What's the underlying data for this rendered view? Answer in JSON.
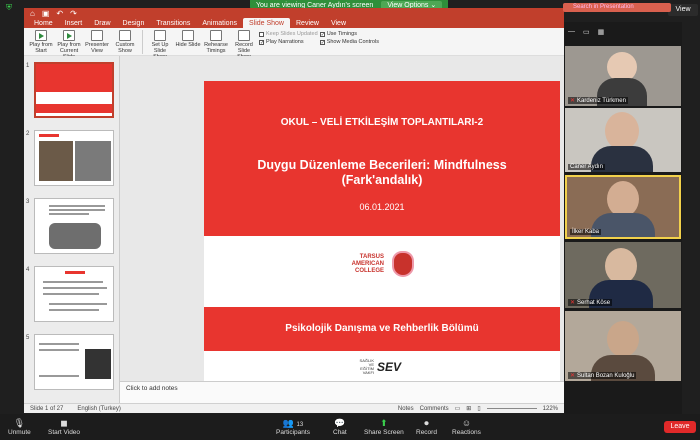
{
  "zoom": {
    "banner_text": "You are viewing Caner Aydın's screen",
    "view_options": "View Options ⌄",
    "view_button": "View",
    "toolbar": [
      {
        "icon": "microphone-muted-icon",
        "label": "Unmute"
      },
      {
        "icon": "video-camera-off-icon",
        "label": "Start Video"
      },
      {
        "icon": "participants-icon",
        "label": "Participants",
        "count": "13"
      },
      {
        "icon": "chat-icon",
        "label": "Chat"
      },
      {
        "icon": "share-screen-icon",
        "label": "Share Screen"
      },
      {
        "icon": "record-icon",
        "label": "Record"
      },
      {
        "icon": "reactions-icon",
        "label": "Reactions"
      }
    ],
    "leave": "Leave",
    "participants": [
      {
        "name": "Kardeniz Türkmen",
        "muted": true
      },
      {
        "name": "Caner Aydın",
        "muted": false
      },
      {
        "name": "İlker Kaba",
        "muted": false,
        "active": true
      },
      {
        "name": "Serhat Köse",
        "muted": true
      },
      {
        "name": "Sultan Bozan Kuloğlu",
        "muted": true
      }
    ]
  },
  "ppt": {
    "search_placeholder": "Search in Presentation",
    "tabs": [
      "Home",
      "Insert",
      "Draw",
      "Design",
      "Transitions",
      "Animations",
      "Slide Show",
      "Review",
      "View"
    ],
    "active_tab": "Slide Show",
    "ribbon_buttons": [
      "Play from Start",
      "Play from Current Slide",
      "Presenter View",
      "Custom Show",
      "Set Up Slide Show",
      "Hide Slide",
      "Rehearse Timings",
      "Record Slide Show"
    ],
    "checkboxes": [
      {
        "label": "Keep Slides Updated",
        "checked": false,
        "disabled": true
      },
      {
        "label": "Use Timings",
        "checked": true
      },
      {
        "label": "Play Narrations",
        "checked": true
      },
      {
        "label": "Show Media Controls",
        "checked": true
      }
    ],
    "thumbnail_numbers": [
      "1",
      "2",
      "3",
      "4",
      "5"
    ],
    "slide": {
      "header": "OKUL – VELİ ETKİLEŞİM TOPLANTILARI-2",
      "title": "Duygu Düzenleme Becerileri: Mindfulness (Fark'andalık)",
      "date": "06.01.2021",
      "logo_text": "TARSUS AMERICAN COLLEGE",
      "department": "Psikolojik Danışma ve Rehberlik Bölümü",
      "footer_small": "SAĞLIK VE EĞİTİM VAKFI",
      "footer_logo": "SEV"
    },
    "notes_placeholder": "Click to add notes",
    "status": {
      "slide_counter": "Slide 1 of 27",
      "language": "English (Turkey)",
      "notes": "Notes",
      "comments": "Comments",
      "zoom": "122%"
    }
  }
}
